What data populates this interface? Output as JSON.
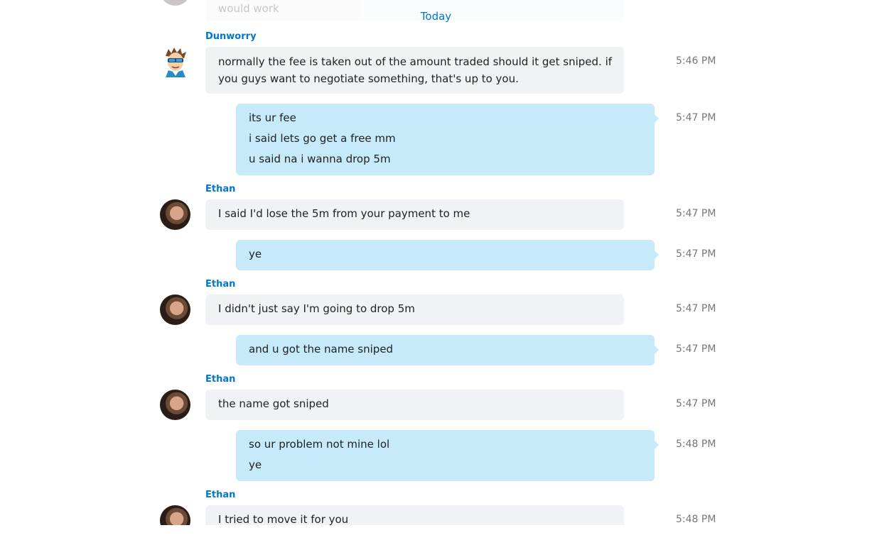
{
  "date_separator": "Today",
  "cut_top_message": {
    "text": "would work"
  },
  "messages": [
    {
      "sender": "Dunworry",
      "lines": [
        "normally the fee is taken out of the amount traded should it get sniped. if",
        "you guys want to negotiate something, that's up to you."
      ],
      "time": "5:46 PM"
    },
    {
      "sender": "",
      "lines": [
        "its ur fee",
        "i said lets go get a free mm",
        "u said na i wanna drop 5m"
      ],
      "time": "5:47 PM"
    },
    {
      "sender": "Ethan",
      "lines": [
        "I said I'd lose the 5m from your payment to me"
      ],
      "time": "5:47 PM"
    },
    {
      "sender": "",
      "lines": [
        "ye"
      ],
      "time": "5:47 PM"
    },
    {
      "sender": "Ethan",
      "lines": [
        "I didn't just say I'm going to drop 5m"
      ],
      "time": "5:47 PM"
    },
    {
      "sender": "",
      "lines": [
        "and u got the name sniped"
      ],
      "time": "5:47 PM"
    },
    {
      "sender": "Ethan",
      "lines": [
        "the name got sniped"
      ],
      "time": "5:47 PM"
    },
    {
      "sender": "",
      "lines": [
        "so ur problem not mine lol",
        "ye"
      ],
      "time": "5:48 PM"
    },
    {
      "sender": "Ethan",
      "lines": [
        "I tried to move it for you"
      ],
      "time": "5:48 PM"
    }
  ],
  "colors": {
    "incoming_bubble": "#f0f2f6",
    "outgoing_bubble": "#c6eafa",
    "sender_name": "#0078c8",
    "timestamp": "#777777"
  },
  "icons": {
    "dunworry_avatar": "cartoon-avatar-icon",
    "ethan_avatar": "profile-photo-avatar"
  }
}
